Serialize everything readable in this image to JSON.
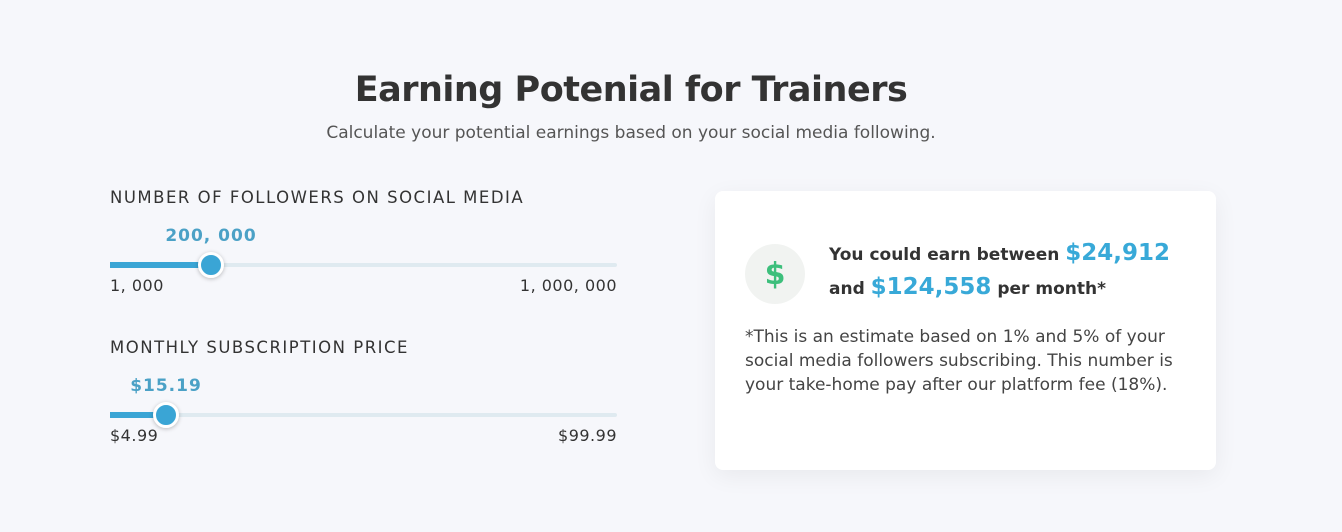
{
  "header": {
    "title": "Earning Potenial for Trainers",
    "subtitle": "Calculate your potential earnings based on your social media following."
  },
  "followers_slider": {
    "label": "NUMBER OF FOLLOWERS ON SOCIAL MEDIA",
    "value_text": "200, 000",
    "min_text": "1, 000",
    "max_text": "1, 000, 000",
    "fraction": 0.2
  },
  "price_slider": {
    "label": "MONTHLY SUBSCRIPTION PRICE",
    "value_text": "$15.19",
    "min_text": "$4.99",
    "max_text": "$99.99",
    "fraction": 0.11
  },
  "result_card": {
    "icon": "dollar-icon",
    "icon_glyph": "$",
    "line1_prefix": "You could earn between ",
    "low_amount": "$24,912",
    "line2_prefix": "and ",
    "high_amount": "$124,558",
    "line2_suffix": " per month*",
    "disclaimer": "*This is an estimate based on 1% and 5% of your social media followers subscribing. This number is your take-home pay after our platform fee (18%)."
  },
  "colors": {
    "background": "#f6f7fb",
    "accent": "#3aa5d5",
    "value_label": "#4ba1c6",
    "icon_green": "#3dbf7c"
  }
}
